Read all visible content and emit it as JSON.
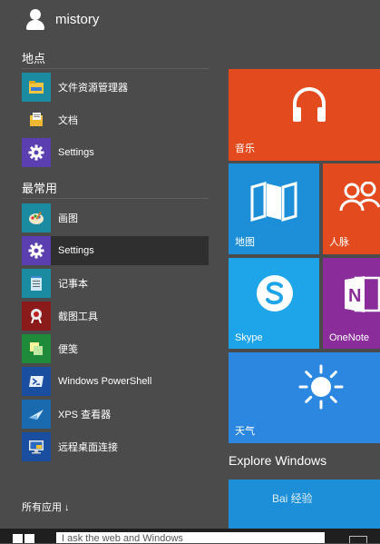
{
  "user": {
    "name": "mistory"
  },
  "places": {
    "title": "地点",
    "items": [
      {
        "label": "文件资源管理器",
        "icon": "file-explorer-icon",
        "color": "#1a8ba0"
      },
      {
        "label": "文档",
        "icon": "documents-icon",
        "color": "#4b4b4b"
      },
      {
        "label": "Settings",
        "icon": "settings-gear-icon",
        "color": "#5b3fb0"
      }
    ]
  },
  "most_used": {
    "title": "最常用",
    "items": [
      {
        "label": "画图",
        "icon": "paint-icon",
        "color": "#1a8ba0"
      },
      {
        "label": "Settings",
        "icon": "settings-gear-icon",
        "color": "#5b3fb0"
      },
      {
        "label": "记事本",
        "icon": "notepad-icon",
        "color": "#1a8ba0"
      },
      {
        "label": "截图工具",
        "icon": "snipping-tool-icon",
        "color": "#8b1a1a"
      },
      {
        "label": "便笺",
        "icon": "sticky-notes-icon",
        "color": "#1e8a3a"
      },
      {
        "label": "Windows PowerShell",
        "icon": "powershell-icon",
        "color": "#1a4fa0"
      },
      {
        "label": "XPS 查看器",
        "icon": "xps-viewer-icon",
        "color": "#1a6ab0"
      },
      {
        "label": "远程桌面连接",
        "icon": "remote-desktop-icon",
        "color": "#1a4fa0"
      }
    ]
  },
  "all_apps": "所有应用 ↓",
  "tiles": {
    "music": {
      "label": "音乐",
      "icon": "headphones-icon",
      "color": "#e34a1e"
    },
    "maps": {
      "label": "地图",
      "icon": "map-icon",
      "color": "#1d8fd8"
    },
    "people": {
      "label": "人脉",
      "icon": "people-icon",
      "color": "#e34a1e"
    },
    "skype": {
      "label": "Skype",
      "icon": "skype-icon",
      "color": "#1ea4e8"
    },
    "onenote": {
      "label": "OneNote",
      "icon": "onenote-icon",
      "color": "#8a2d9a"
    },
    "weather": {
      "label": "天气",
      "icon": "sun-icon",
      "color": "#2b87e0"
    }
  },
  "explore": {
    "title": "Explore Windows",
    "color": "#1d8fd8"
  },
  "taskbar": {
    "search_text": "I         ask the web and Windows"
  },
  "watermark": "Bai 经验"
}
